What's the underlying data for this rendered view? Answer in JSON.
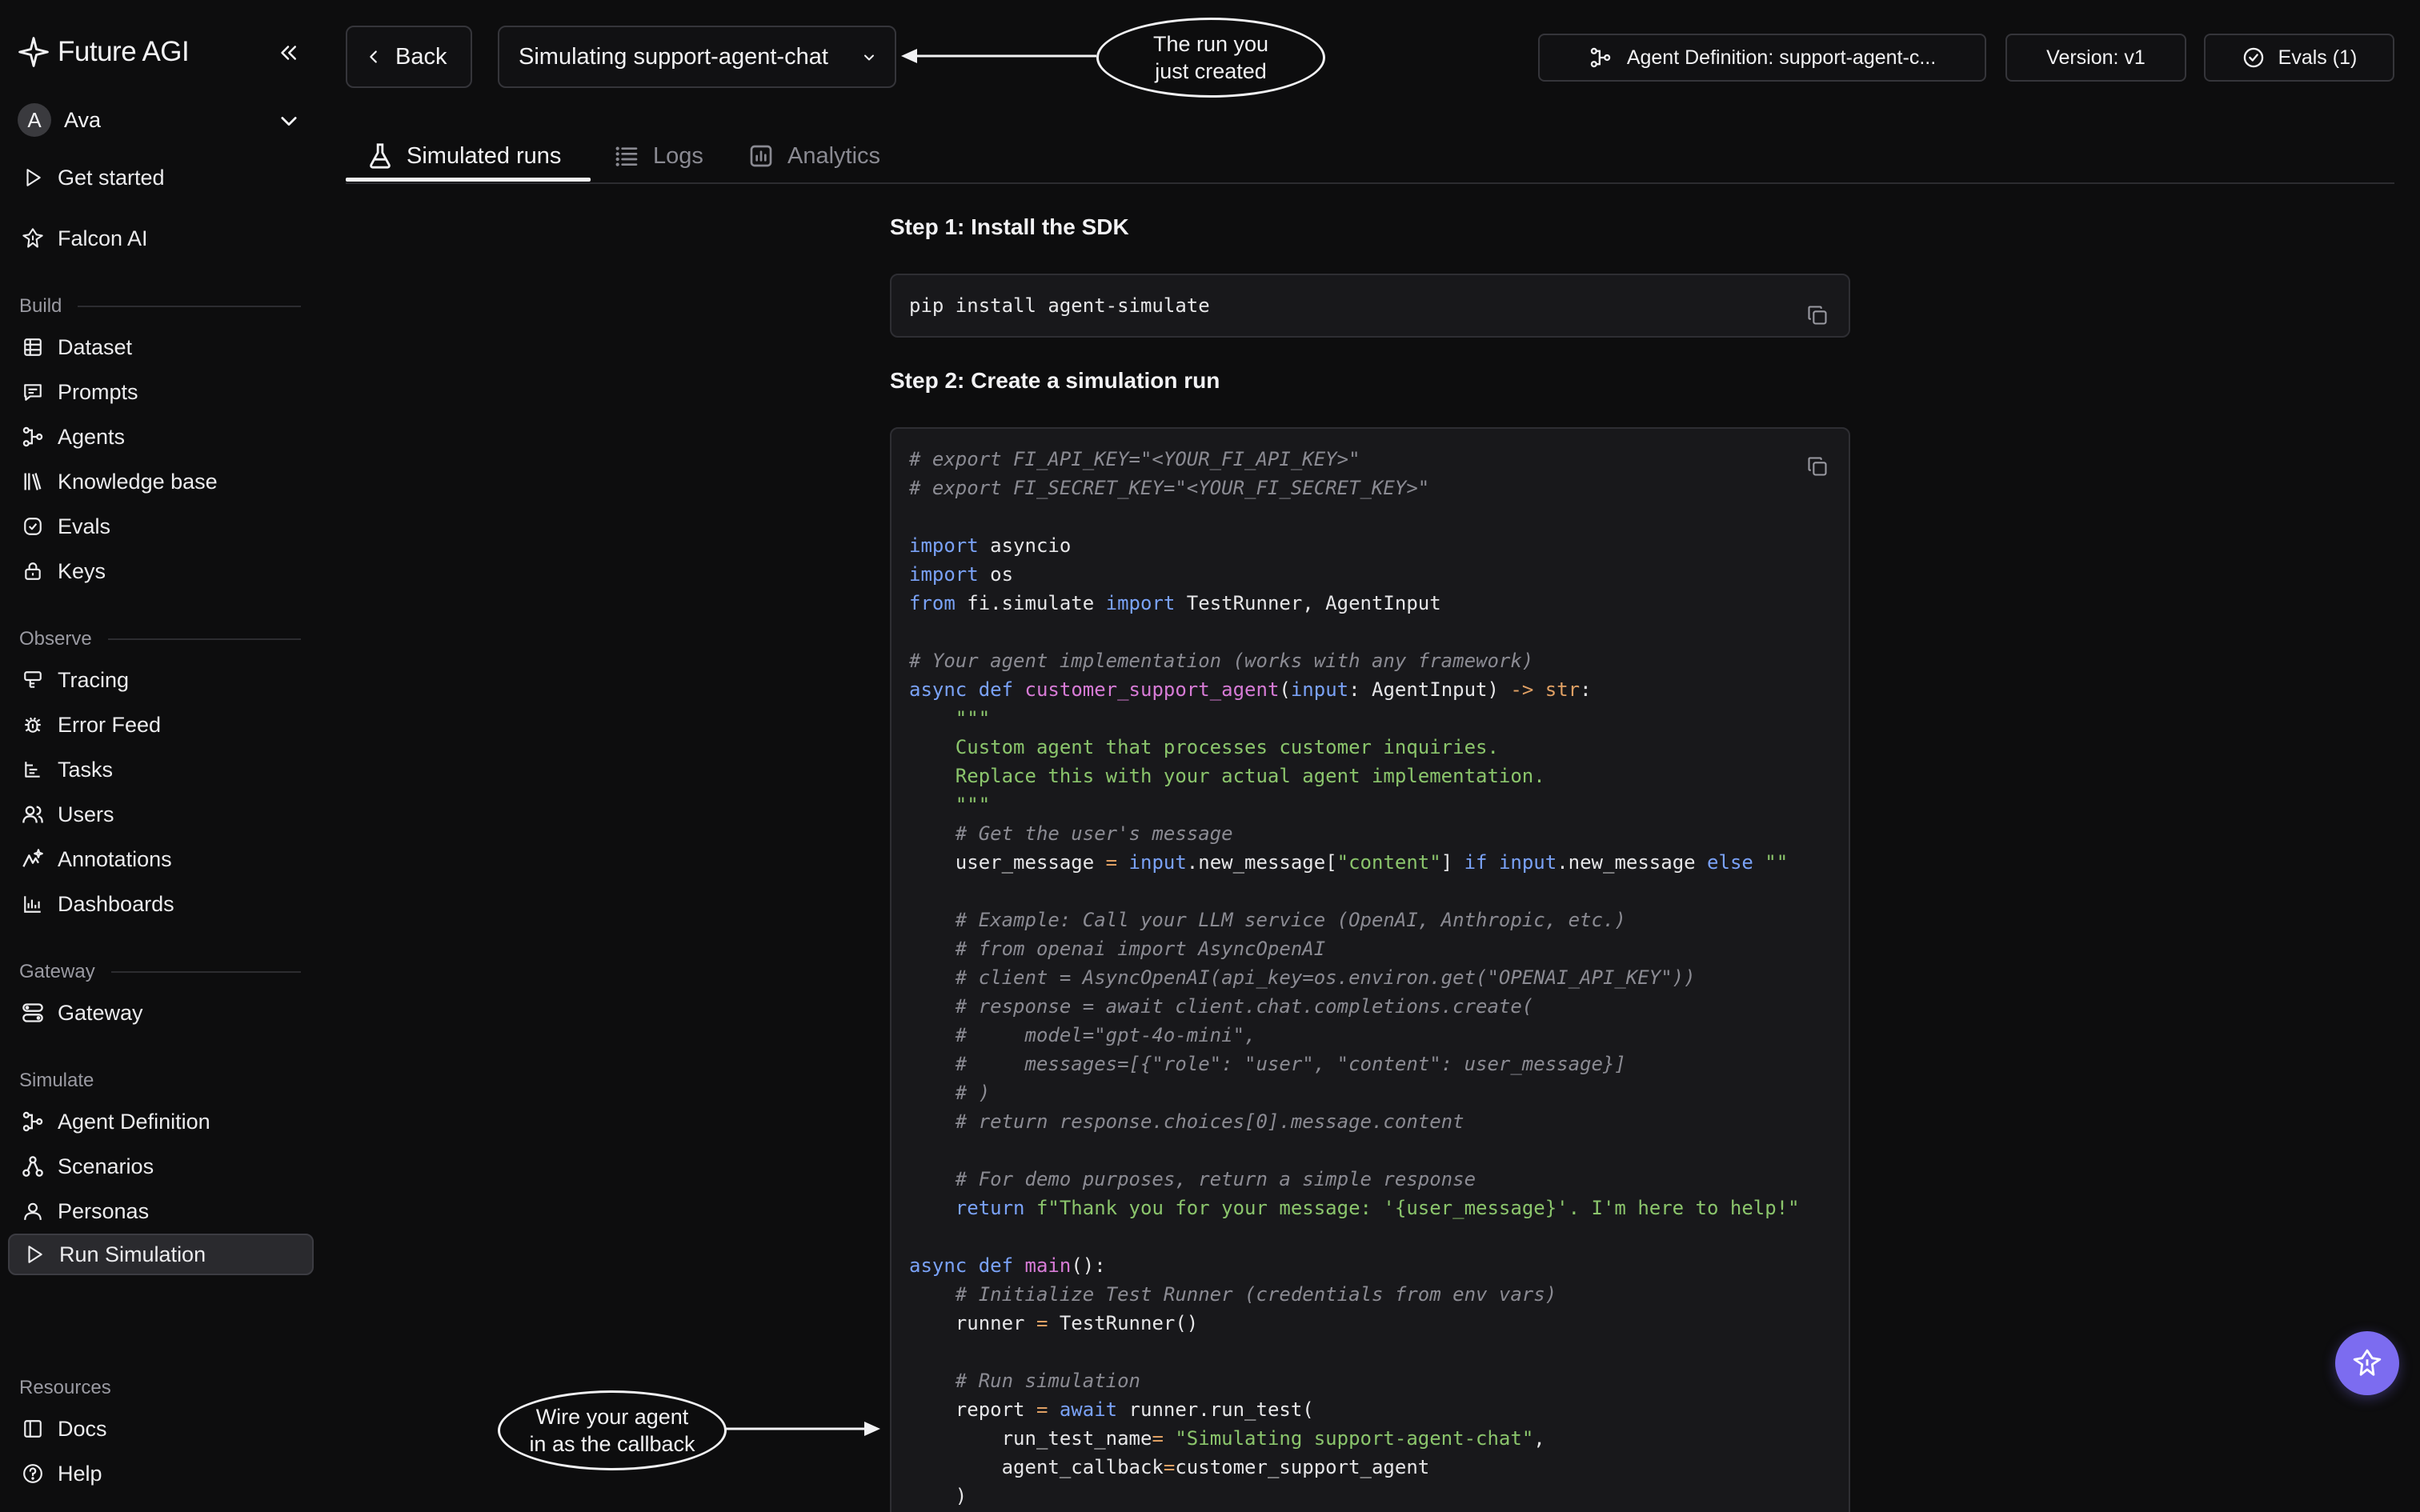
{
  "brand": {
    "name": "Future AGI"
  },
  "user": {
    "initial": "A",
    "name": "Ava"
  },
  "nav_top": [
    {
      "label": "Get started",
      "icon": "play-icon"
    },
    {
      "label": "Falcon AI",
      "icon": "falcon-icon"
    }
  ],
  "sections": {
    "build": "Build",
    "observe": "Observe",
    "gateway": "Gateway",
    "simulate": "Simulate",
    "resources": "Resources"
  },
  "nav_build": [
    "Dataset",
    "Prompts",
    "Agents",
    "Knowledge base",
    "Evals",
    "Keys"
  ],
  "nav_observe": [
    "Tracing",
    "Error Feed",
    "Tasks",
    "Users",
    "Annotations",
    "Dashboards"
  ],
  "nav_gateway": [
    "Gateway"
  ],
  "nav_simulate": [
    "Agent Definition",
    "Scenarios",
    "Personas",
    "Run Simulation"
  ],
  "nav_resources": [
    "Docs",
    "Help"
  ],
  "topbar": {
    "back_label": "Back",
    "run_name": "Simulating support-agent-chat",
    "agent_definition": "Agent Definition: support-agent-c...",
    "version": "Version: v1",
    "evals": "Evals (1)"
  },
  "annotations": {
    "run_created": [
      "The run you",
      "just created"
    ],
    "wire_agent": [
      "Wire your agent",
      "in as the callback"
    ]
  },
  "tabs": [
    "Simulated runs",
    "Logs",
    "Analytics"
  ],
  "step1": {
    "title": "Step 1: Install the SDK",
    "code": "pip install agent-simulate"
  },
  "step2": {
    "title": "Step 2: Create a simulation run",
    "code_lines": [
      "# export FI_API_KEY=\"<YOUR_FI_API_KEY>\"",
      "# export FI_SECRET_KEY=\"<YOUR_FI_SECRET_KEY>\"",
      "",
      "import asyncio",
      "import os",
      "from fi.simulate import TestRunner, AgentInput",
      "",
      "# Your agent implementation (works with any framework)",
      "async def customer_support_agent(input: AgentInput) -> str:",
      "    \"\"\"",
      "    Custom agent that processes customer inquiries.",
      "    Replace this with your actual agent implementation.",
      "    \"\"\"",
      "    # Get the user's message",
      "    user_message = input.new_message[\"content\"] if input.new_message else \"\"",
      "",
      "    # Example: Call your LLM service (OpenAI, Anthropic, etc.)",
      "    # from openai import AsyncOpenAI",
      "    # client = AsyncOpenAI(api_key=os.environ.get(\"OPENAI_API_KEY\"))",
      "    # response = await client.chat.completions.create(",
      "    #     model=\"gpt-4o-mini\",",
      "    #     messages=[{\"role\": \"user\", \"content\": user_message}]",
      "    # )",
      "    # return response.choices[0].message.content",
      "",
      "    # For demo purposes, return a simple response",
      "    return f\"Thank you for your message: '{user_message}'. I'm here to help!\"",
      "",
      "async def main():",
      "    # Initialize Test Runner (credentials from env vars)",
      "    runner = TestRunner()",
      "",
      "    # Run simulation",
      "    report = await runner.run_test(",
      "        run_test_name= \"Simulating support-agent-chat\",",
      "        agent_callback=customer_support_agent",
      "    )"
    ]
  },
  "colors": {
    "accent": "#7c6cf0",
    "keyword": "#7aa2f7",
    "function": "#d77bd6",
    "string": "#8bc56c",
    "comment": "#8b8b93"
  }
}
